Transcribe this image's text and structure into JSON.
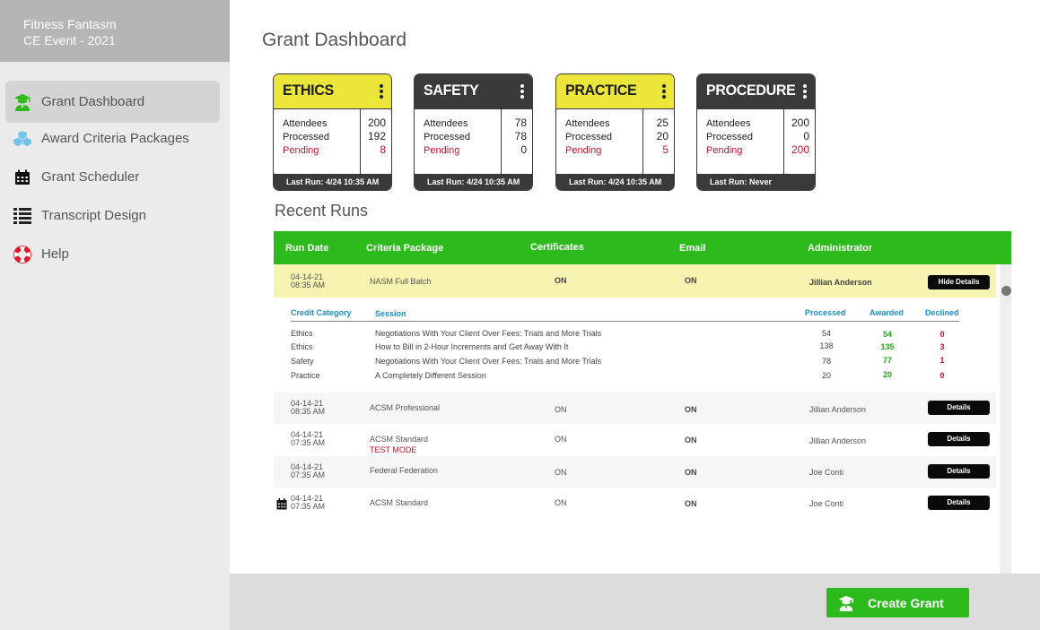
{
  "brand": {
    "line1": "Fitness Fantasm",
    "line2": "CE Event - 2021"
  },
  "sidebar": {
    "items": [
      {
        "label": "Grant Dashboard",
        "icon": "graduate-icon",
        "active": true
      },
      {
        "label": "Award Criteria Packages",
        "icon": "boxes-icon"
      },
      {
        "label": "Grant Scheduler",
        "icon": "calendar-icon"
      },
      {
        "label": "Transcript Design",
        "icon": "list-icon"
      },
      {
        "label": "Help",
        "icon": "lifebuoy-icon"
      }
    ]
  },
  "page": {
    "title": "Grant Dashboard",
    "recent_title": "Recent Runs"
  },
  "cards": [
    {
      "title": "ETHICS",
      "style": "yellow",
      "labels": [
        "Attendees",
        "Processed",
        "Pending"
      ],
      "attendees": "200",
      "processed": "192",
      "pending": "8",
      "footer": "Last Run: 4/24 10:35 AM"
    },
    {
      "title": "SAFETY",
      "style": "dark",
      "labels": [
        "Attendees",
        "Processed",
        "Pending"
      ],
      "attendees": "78",
      "processed": "78",
      "pending": "0",
      "footer": "Last Run: 4/24 10:35 AM"
    },
    {
      "title": "PRACTICE",
      "style": "yellow",
      "labels": [
        "Attendees",
        "Processed",
        "Pending"
      ],
      "attendees": "25",
      "processed": "20",
      "pending": "5",
      "footer": "Last Run: 4/24 10:35 AM"
    },
    {
      "title": "PROCEDURE",
      "style": "dark",
      "labels": [
        "Attendees",
        "Processed",
        "Pending"
      ],
      "attendees": "200",
      "processed": "0",
      "pending": "200",
      "footer": "Last Run: Never"
    }
  ],
  "table": {
    "headers": {
      "run_date": "Run Date",
      "criteria": "Criteria Package",
      "certificates": "Certificates",
      "email": "Email",
      "admin": "Administrator"
    },
    "rows": [
      {
        "date": "04-14-21",
        "time": "08:35 AM",
        "package": "NASM Full Batch",
        "certificates": "ON",
        "email": "ON",
        "admin": "Jillian Anderson",
        "button": "Hide Details"
      },
      {
        "date": "04-14-21",
        "time": "08:35 AM",
        "package": "ACSM Professional",
        "certificates": "ON",
        "email": "ON",
        "admin": "Jillian Anderson",
        "button": "Details"
      },
      {
        "date": "04-14-21",
        "time": "07:35 AM",
        "package": "ACSM Standard",
        "tag": "TEST MODE",
        "certificates": "ON",
        "email": "ON",
        "admin": "Jillian Anderson",
        "button": "Details"
      },
      {
        "date": "04-14-21",
        "time": "07:35 AM",
        "package": "Federal Federation",
        "certificates": "ON",
        "email": "ON",
        "admin": "Joe Conti",
        "button": "Details"
      },
      {
        "date": "04-14-21",
        "time": "07:35 AM",
        "package": "ACSM Standard",
        "certificates": "ON",
        "email": "ON",
        "admin": "Joe Conti",
        "button": "Details",
        "scheduled": true
      }
    ],
    "details": {
      "headers": {
        "category": "Credit Category",
        "session": "Session",
        "processed": "Processed",
        "awarded": "Awarded",
        "declined": "Declined"
      },
      "rows": [
        {
          "category": "Ethics",
          "session": "Negotiations With Your Client Over Fees: Trials and More Trials",
          "processed": "54",
          "awarded": "54",
          "declined": "0"
        },
        {
          "category": "Ethics",
          "session": "How to Bill in 2-Hour Increments and Get Away With It",
          "processed": "138",
          "awarded": "135",
          "declined": "3"
        },
        {
          "category": "Safety",
          "session": "Negotiations With Your Client Over Fees: Trials and More Trials",
          "processed": "78",
          "awarded": "77",
          "declined": "1"
        },
        {
          "category": "Practice",
          "session": "A Completely Different Session",
          "processed": "20",
          "awarded": "20",
          "declined": "0"
        }
      ]
    }
  },
  "footer": {
    "create_label": "Create Grant"
  },
  "colors": {
    "green": "#2dba1c",
    "yellow": "#ece63b",
    "dark": "#3a3a3a",
    "red": "#c0142c",
    "blue": "#1b8fc5"
  }
}
